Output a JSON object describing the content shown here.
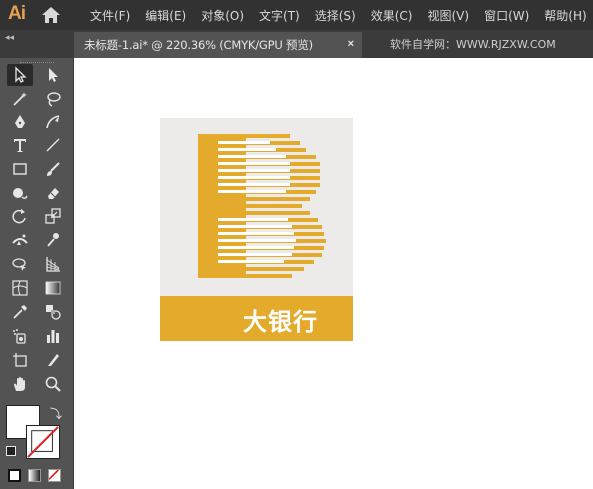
{
  "app": {
    "logo_text": "Ai",
    "brand_color": "#E7A04F"
  },
  "menu": [
    {
      "label": "文件(F)"
    },
    {
      "label": "编辑(E)"
    },
    {
      "label": "对象(O)"
    },
    {
      "label": "文字(T)"
    },
    {
      "label": "选择(S)"
    },
    {
      "label": "效果(C)"
    },
    {
      "label": "视图(V)"
    },
    {
      "label": "窗口(W)"
    },
    {
      "label": "帮助(H)"
    }
  ],
  "tab": {
    "collapse_label": "◂◂",
    "document_label": "未标题-1.ai* @ 220.36% (CMYK/GPU 预览)",
    "close_label": "×"
  },
  "watermark": "软件自学网：WWW.RJZXW.COM",
  "tools": [
    "selection-tool",
    "direct-selection-tool",
    "magic-wand-tool",
    "lasso-tool",
    "pen-tool",
    "curvature-tool",
    "type-tool",
    "line-segment-tool",
    "rectangle-tool",
    "paintbrush-tool",
    "shaper-tool",
    "eraser-tool",
    "rotate-tool",
    "scale-tool",
    "width-tool",
    "puppet-warp-tool",
    "shape-builder-tool",
    "perspective-grid-tool",
    "mesh-tool",
    "gradient-tool",
    "eyedropper-tool",
    "blend-tool",
    "symbol-sprayer-tool",
    "column-graph-tool",
    "artboard-tool",
    "slice-tool",
    "hand-tool",
    "zoom-tool"
  ],
  "artwork": {
    "text": "大银行",
    "background_color": "#ECEBE9",
    "accent_color": "#E3AA2B"
  }
}
